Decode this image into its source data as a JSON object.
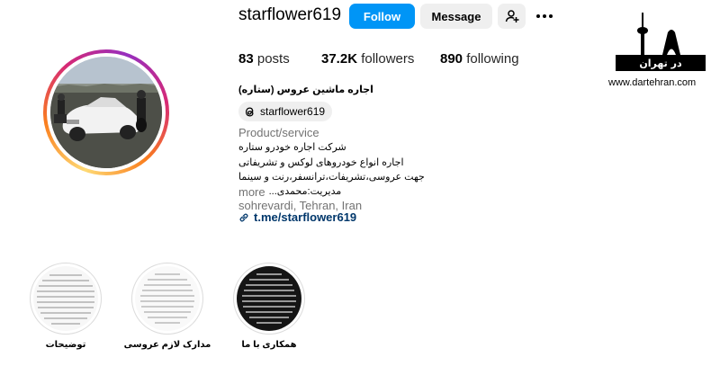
{
  "profile": {
    "username": "starflower619",
    "follow_label": "Follow",
    "message_label": "Message",
    "add_user_icon": "add-user-icon",
    "more_icon": "more-options-icon"
  },
  "stats": {
    "posts_count": "83",
    "posts_label": "posts",
    "followers_count": "37.2K",
    "followers_label": "followers",
    "following_count": "890",
    "following_label": "following"
  },
  "bio": {
    "full_name": "اجاره ماشین عروس (ستاره)",
    "threads_handle": "starflower619",
    "threads_icon": "threads-icon",
    "category": "Product/service",
    "lines": [
      "شرکت اجاره خودرو ستاره",
      "اجاره انواع خودروهای لوکس و تشریفاتی",
      "جهت عروسی،تشریفات،ترانسفر،رنت و سینما",
      "مدیریت:محمدی..."
    ],
    "more_label": "more",
    "location": "sohrevardi, Tehran, Iran",
    "link_icon": "link-icon",
    "link_text": "t.me/starflower619"
  },
  "highlights": [
    {
      "label": "توضیحات",
      "style": "white-text"
    },
    {
      "label": "مدارک لازم عروسی",
      "style": "white-text"
    },
    {
      "label": "همکاری با ما",
      "style": "dark-text"
    }
  ],
  "watermark": {
    "logo_text": "در تهران",
    "site": "www.dartehran.com"
  },
  "colors": {
    "follow_button": "#0095f6",
    "secondary_button": "#efefef",
    "link": "#00376b",
    "muted_text": "#737373"
  }
}
